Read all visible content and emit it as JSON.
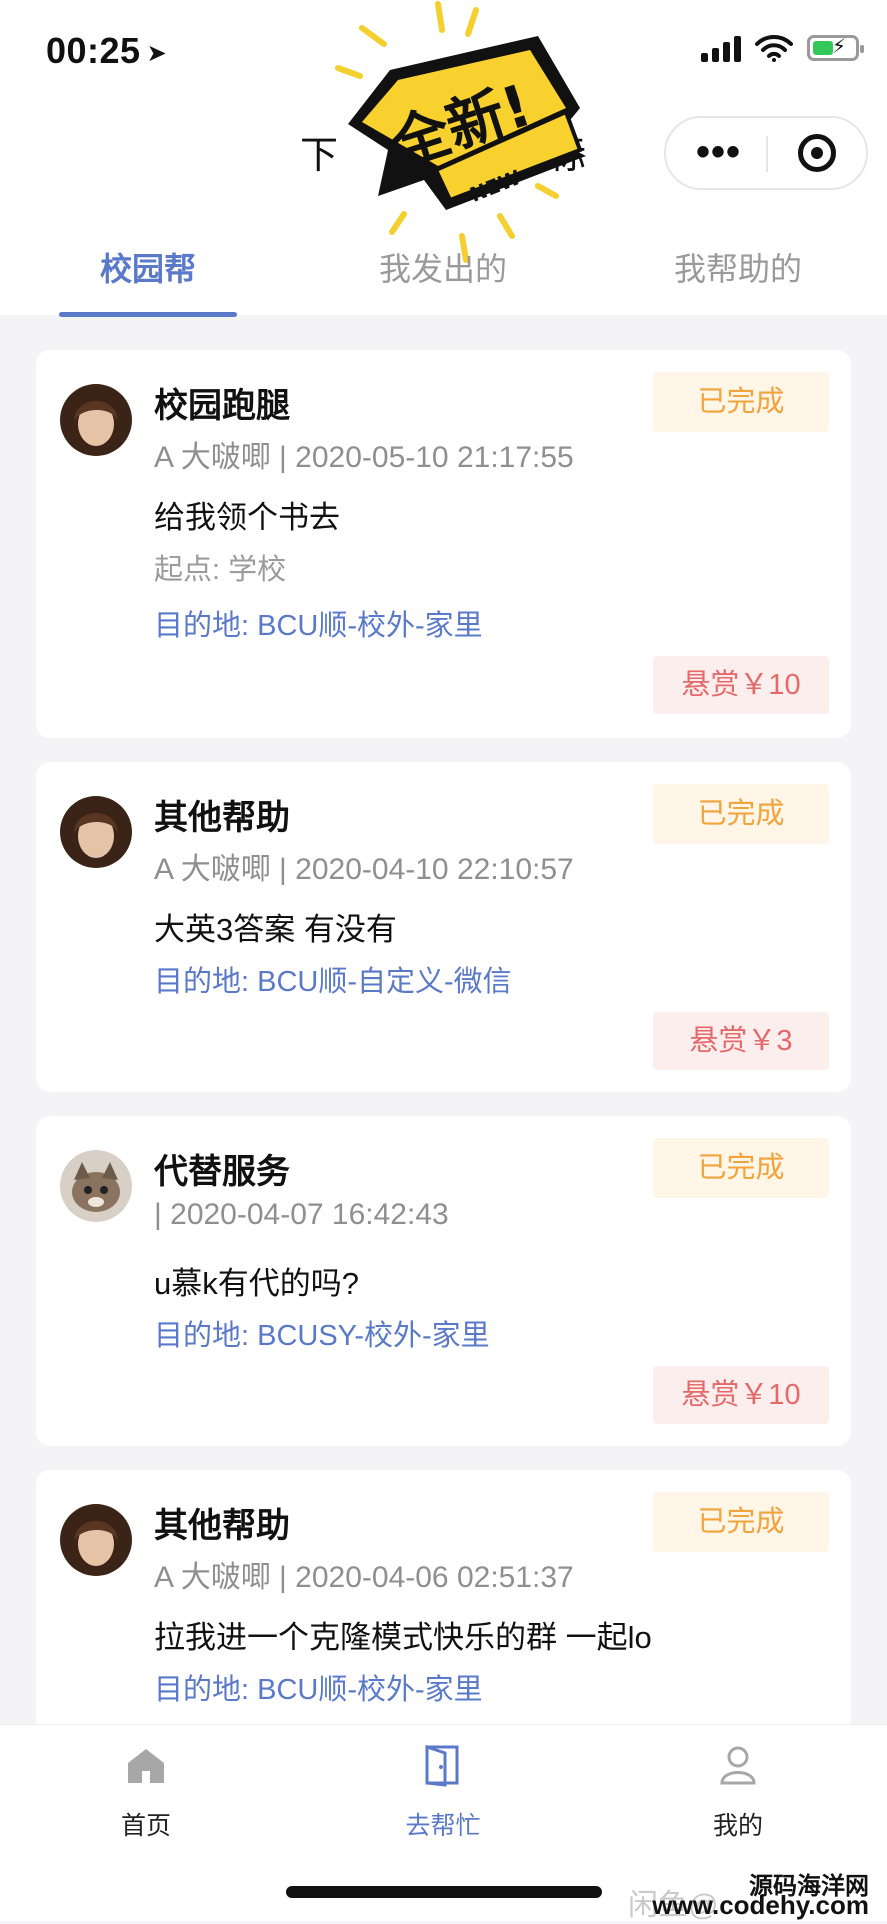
{
  "status_bar": {
    "time": "00:25",
    "location_arrow": "location-arrow-icon"
  },
  "header": {
    "title_left": "下",
    "title_right": "标",
    "badge_text": "全新!",
    "badge_sub": "NEW"
  },
  "tabs": [
    {
      "label": "校园帮",
      "active": true
    },
    {
      "label": "我发出的",
      "active": false
    },
    {
      "label": "我帮助的",
      "active": false
    }
  ],
  "cards": [
    {
      "title": "校园跑腿",
      "meta": "A 大啵唧 | 2020-05-10 21:17:55",
      "desc": "给我领个书去",
      "origin": "起点: 学校",
      "dest": "目的地: BCU顺-校外-家里",
      "status": "已完成",
      "reward": "悬赏￥10"
    },
    {
      "title": "其他帮助",
      "meta": "A 大啵唧 | 2020-04-10 22:10:57",
      "desc": "大英3答案 有没有",
      "dest": "目的地: BCU顺-自定义-微信",
      "status": "已完成",
      "reward": "悬赏￥3"
    },
    {
      "title": "代替服务",
      "meta": "| 2020-04-07 16:42:43",
      "desc": "u慕k有代的吗?",
      "dest": "目的地: BCUSY-校外-家里",
      "status": "已完成",
      "reward": "悬赏￥10"
    },
    {
      "title": "其他帮助",
      "meta": "A 大啵唧 | 2020-04-06 02:51:37",
      "desc": "拉我进一个克隆模式快乐的群 一起lo",
      "dest": "目的地: BCU顺-校外-家里",
      "status": "已完成"
    }
  ],
  "tabbar": [
    {
      "label": "首页",
      "icon": "home-icon"
    },
    {
      "label": "去帮忙",
      "icon": "door-icon"
    },
    {
      "label": "我的",
      "icon": "user-icon"
    }
  ],
  "watermark": {
    "line1": "源码海洋网",
    "line2": "闲鱼@",
    "line3": "www.codehy.com"
  },
  "colors": {
    "accent": "#5b79c9",
    "status_orange": "#f1a33c",
    "reward_red": "#e46a6a"
  }
}
